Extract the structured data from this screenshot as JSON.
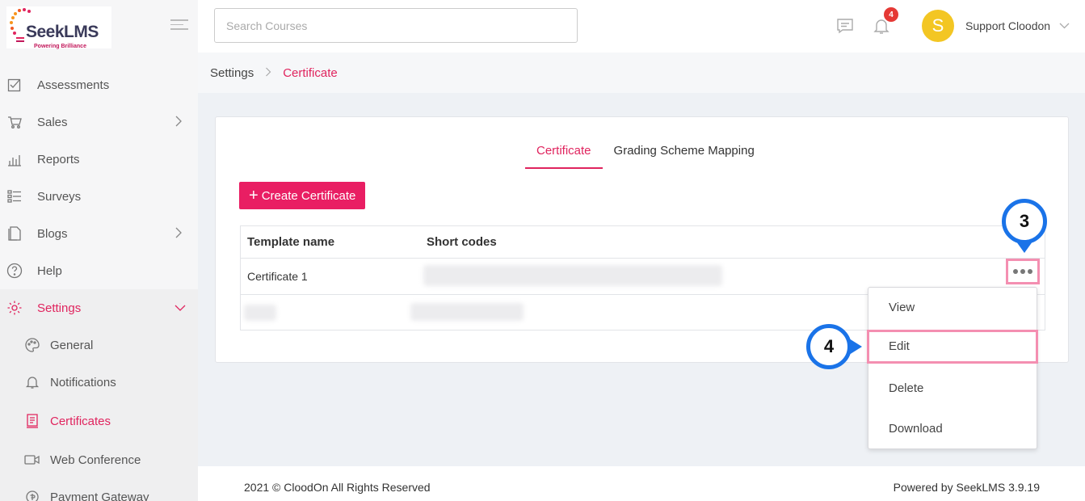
{
  "brand": {
    "name": "SeekLMS",
    "tagline": "Powering Brilliance"
  },
  "header": {
    "search_placeholder": "Search Courses",
    "notification_count": "4",
    "avatar_initial": "S",
    "user_name": "Support Cloodon"
  },
  "sidebar": {
    "items": [
      {
        "label": "Assessments",
        "icon": "checklist-icon"
      },
      {
        "label": "Sales",
        "icon": "cart-icon",
        "has_children": true
      },
      {
        "label": "Reports",
        "icon": "bar-chart-icon"
      },
      {
        "label": "Surveys",
        "icon": "list-icon"
      },
      {
        "label": "Blogs",
        "icon": "document-icon",
        "has_children": true
      },
      {
        "label": "Help",
        "icon": "help-icon"
      },
      {
        "label": "Settings",
        "icon": "gear-icon",
        "expanded": true
      }
    ],
    "sub_items": [
      {
        "label": "General",
        "icon": "palette-icon"
      },
      {
        "label": "Notifications",
        "icon": "bell-icon"
      },
      {
        "label": "Certificates",
        "icon": "certificate-icon"
      },
      {
        "label": "Web Conference",
        "icon": "video-icon"
      },
      {
        "label": "Payment Gateway",
        "icon": "payment-icon"
      }
    ]
  },
  "breadcrumb": {
    "parent": "Settings",
    "current": "Certificate"
  },
  "tabs": [
    {
      "label": "Certificate"
    },
    {
      "label": "Grading Scheme Mapping"
    }
  ],
  "create_button": "Create Certificate",
  "table": {
    "columns": [
      "Template name",
      "Short codes"
    ],
    "rows": [
      {
        "name": "Certificate 1"
      }
    ]
  },
  "dropdown": {
    "items": [
      "View",
      "Edit",
      "Delete",
      "Download"
    ]
  },
  "callouts": {
    "first": "3",
    "second": "4"
  },
  "footer": {
    "copyright": "2021 © CloodOn All Rights Reserved",
    "powered": "Powered by SeekLMS 3.9.19"
  },
  "colors": {
    "accent": "#e91e63",
    "callout": "#1a73e8",
    "highlight": "#f48fb1"
  }
}
